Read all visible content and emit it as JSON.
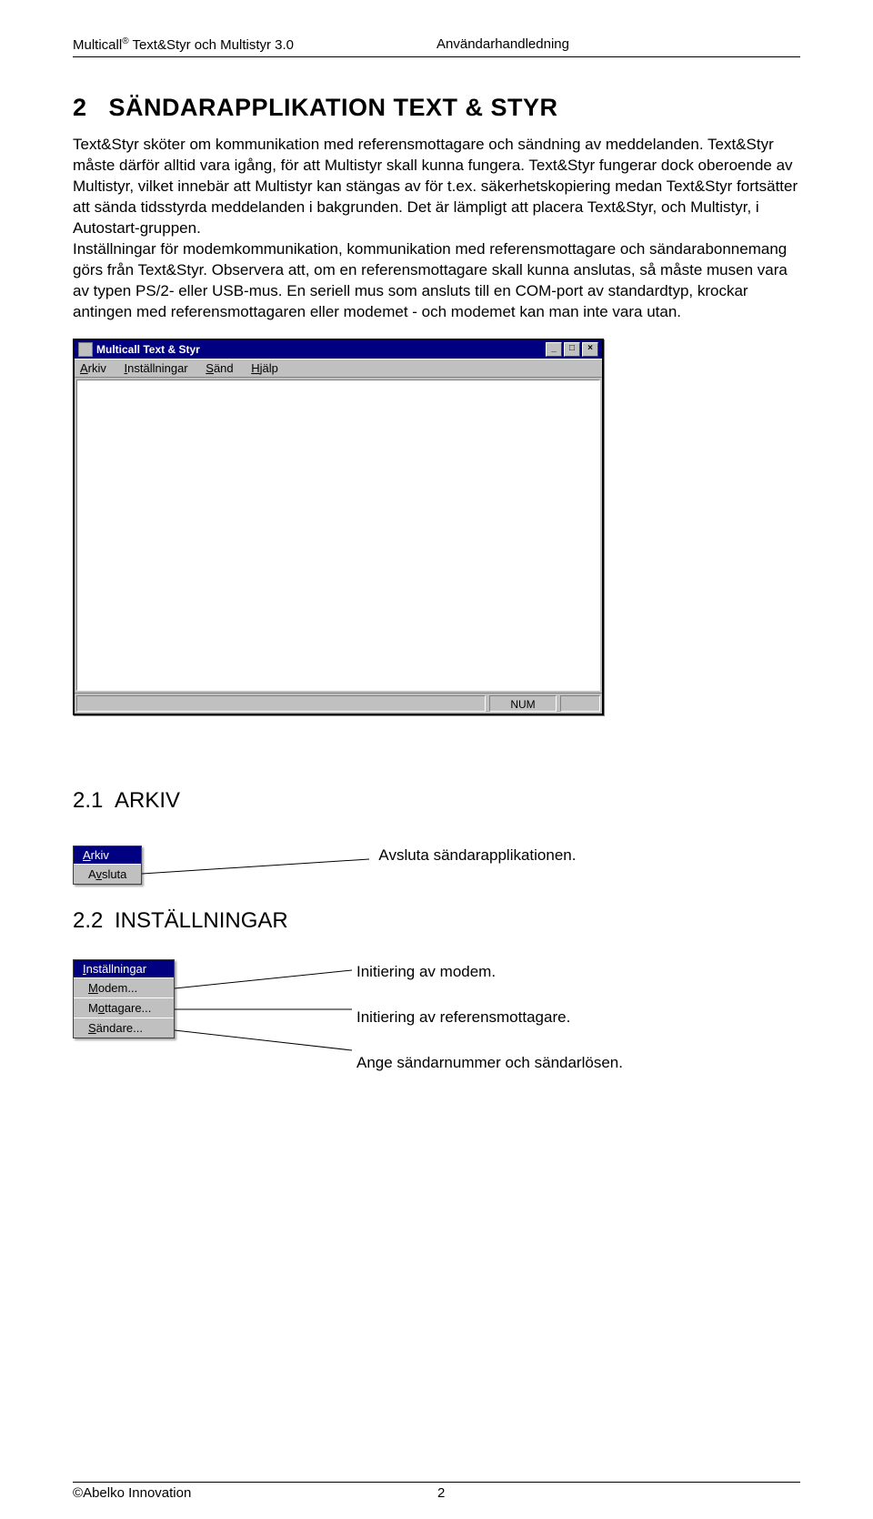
{
  "header": {
    "product": "Multicall",
    "trademark": "®",
    "title_suffix": " Text&Styr och Multistyr 3.0",
    "doc": "Användarhandledning"
  },
  "sec2": {
    "num": "2",
    "title": "SÄNDARAPPLIKATION TEXT & STYR",
    "body": "Text&Styr sköter om kommunikation med referensmottagare och sändning av meddelanden. Text&Styr måste därför alltid vara igång, för att Multistyr skall kunna fungera. Text&Styr fungerar dock oberoende av Multistyr, vilket innebär att Multistyr kan stängas av för t.ex. säkerhetskopiering medan Text&Styr fortsätter att sända tidsstyrda meddelanden i bakgrunden. Det är lämpligt att placera Text&Styr, och Multistyr, i Autostart-gruppen.\nInställningar för modemkommunikation, kommunikation med referensmottagare och sändarabonnemang görs från Text&Styr. Observera att, om en referensmottagare skall kunna anslutas, så måste musen vara av typen PS/2- eller USB-mus. En seriell mus som ansluts till en COM-port av standardtyp, krockar antingen med referensmottagaren eller modemet - och modemet kan man inte vara utan."
  },
  "appwin": {
    "title": "Multicall Text & Styr",
    "menu": [
      "Arkiv",
      "Inställningar",
      "Sänd",
      "Hjälp"
    ],
    "status_num": "NUM"
  },
  "sec21": {
    "num": "2.1",
    "title": "ARKIV"
  },
  "arkiv_menu": {
    "header": "Arkiv",
    "item": "Avsluta"
  },
  "arkiv_label": "Avsluta sändarapplikationen.",
  "sec22": {
    "num": "2.2",
    "title": "INSTÄLLNINGAR"
  },
  "inst_menu": {
    "header": "Inställningar",
    "items": [
      "Modem...",
      "Mottagare...",
      "Sändare..."
    ]
  },
  "inst_labels": [
    "Initiering av modem.",
    "Initiering av referensmottagare.",
    "Ange sändarnummer och sändarlösen."
  ],
  "footer": {
    "left_prefix": "©",
    "left": "Abelko Innovation",
    "page": "2"
  }
}
